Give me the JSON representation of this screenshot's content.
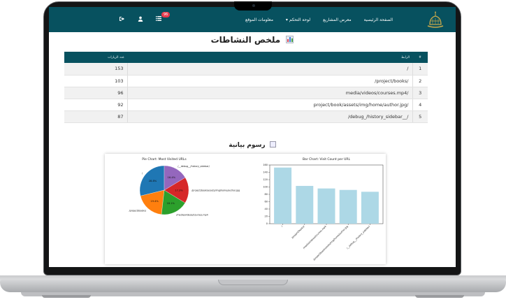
{
  "nav": {
    "links": [
      "الصفحة الرئيسية",
      "معرض المشاريع",
      "لوحة التحكم ▾",
      "معلومات الموقع"
    ],
    "badge": "96"
  },
  "page": {
    "title": "ملخص النشاطات",
    "charts_heading": "رسوم بيانية"
  },
  "table": {
    "headers": {
      "index": "#",
      "url": "الرابط",
      "count": "عدد الزيارات"
    },
    "rows": [
      {
        "index": "1",
        "url": "/",
        "count": "153"
      },
      {
        "index": "2",
        "url": "/project/books/",
        "count": "103"
      },
      {
        "index": "3",
        "url": "media/videos/courses.mp4/",
        "count": "96"
      },
      {
        "index": "4",
        "url": "project/book/assets/img/home/author.jpg/",
        "count": "92"
      },
      {
        "index": "5",
        "url": "/debug_/history_sidebar__/",
        "count": "87"
      }
    ]
  },
  "chart_data": [
    {
      "type": "pie",
      "title": "Pie Chart: Most Visited URLs",
      "categories": [
        "/",
        "/project/books/",
        "/media/videos/courses.mp4",
        "/project/book/assets/img/home/author.jpg",
        "/__debug__/history_sidebar/"
      ],
      "values": [
        153,
        103,
        96,
        92,
        87
      ],
      "labels": [
        "28.8%",
        "19.4%",
        "18.1%",
        "17.3%",
        "16.4%"
      ],
      "colors": [
        "#1f77b4",
        "#ff7f0e",
        "#2ca02c",
        "#d62728",
        "#9467bd"
      ]
    },
    {
      "type": "bar",
      "title": "Bar Chart: Visit Count per URL",
      "categories": [
        "/",
        "/project/books/",
        "/media/videos/courses.mp4",
        "/project/book/assets/img/home/author.jpg",
        "/__debug__/history_sidebar/"
      ],
      "values": [
        153,
        103,
        96,
        92,
        87
      ],
      "ylim": [
        0,
        160
      ],
      "yticks": [
        0,
        20,
        40,
        60,
        80,
        100,
        120,
        140,
        160
      ],
      "bar_color": "#add8e6"
    }
  ]
}
